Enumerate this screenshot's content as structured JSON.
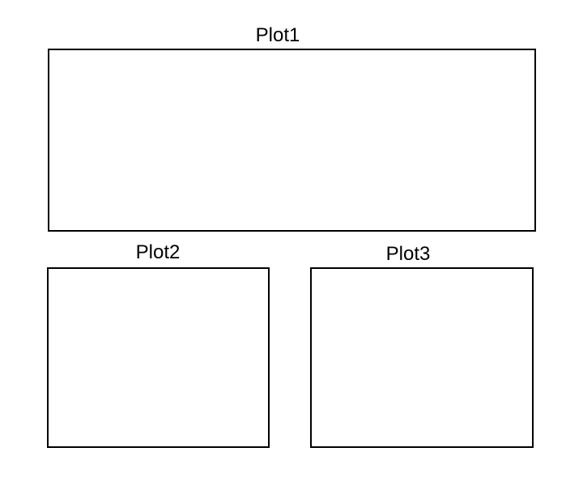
{
  "plots": [
    {
      "title": "Plot1"
    },
    {
      "title": "Plot2"
    },
    {
      "title": "Plot3"
    }
  ],
  "colors": {
    "border": "#000000",
    "text": "#000000",
    "background": "#ffffff"
  }
}
